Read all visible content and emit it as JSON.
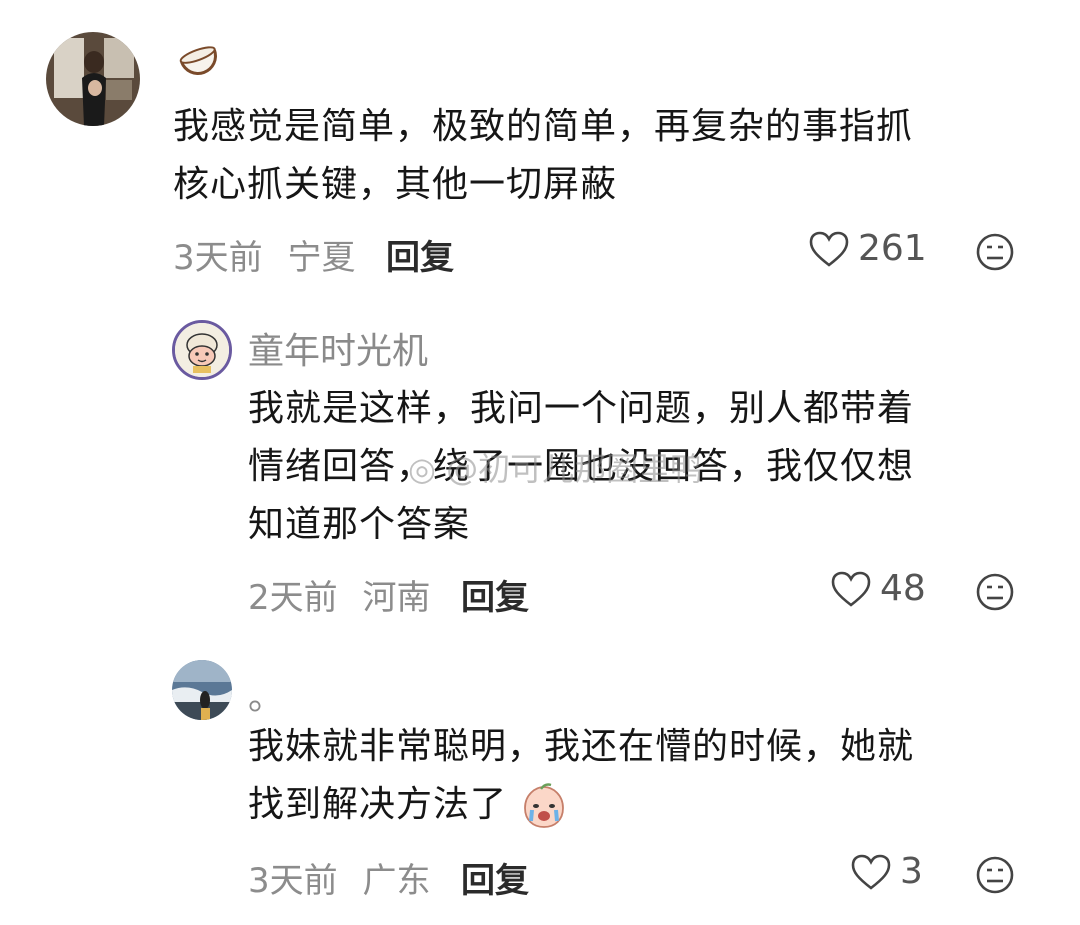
{
  "comments": [
    {
      "name": "",
      "text_lines": [
        "我感觉是简单，极致的简单，再复杂的事指抓",
        "核心抓关键，其他一切屏蔽"
      ],
      "time": "3天前",
      "location": "宁夏",
      "reply_label": "回复",
      "likes": "261",
      "name_emoji": "coconut-icon"
    },
    {
      "name": "童年时光机",
      "text_lines": [
        "我就是这样，我问一个问题，别人都带着",
        "情绪回答，绕了一圈也没回答，我仅仅想",
        "知道那个答案"
      ],
      "time": "2天前",
      "location": "河南",
      "reply_label": "回复",
      "likes": "48"
    },
    {
      "name": "。",
      "text_lines": [
        "我妹就非常聪明，我还在懵的时候，她就",
        "找到解决方法了"
      ],
      "time": "3天前",
      "location": "广东",
      "reply_label": "回复",
      "likes": "3",
      "inline_emoji": "crying-peach-emoji"
    }
  ],
  "watermark": "@初可儿那圈里鸭",
  "colors": {
    "text": "#161616",
    "meta": "#8c8c8c",
    "name": "#8a8a8a"
  }
}
